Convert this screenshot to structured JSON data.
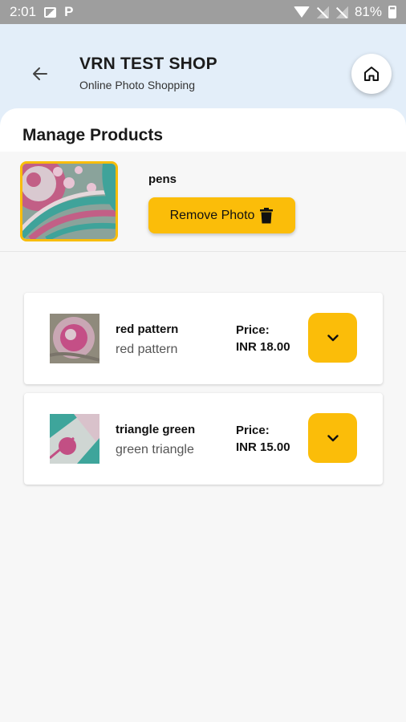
{
  "status_bar": {
    "time": "2:01",
    "battery": "81%",
    "icons": [
      "image-icon",
      "parking-icon",
      "wifi-icon",
      "signal-off-icon",
      "signal-off-icon",
      "battery-icon"
    ]
  },
  "header": {
    "title": "VRN TEST SHOP",
    "subtitle": "Online Photo Shopping",
    "back_icon": "back-arrow-icon",
    "home_icon": "home-icon",
    "background_color": "#e3eef9"
  },
  "page": {
    "section_title": "Manage Products"
  },
  "selected_product": {
    "name": "pens",
    "remove_label": "Remove Photo",
    "remove_icon": "trash-icon",
    "accent_color": "#fbbd09"
  },
  "products": [
    {
      "title": "red pattern",
      "subtitle": "red pattern",
      "price_label": "Price:",
      "price": "INR 18.00",
      "action_icon": "chevron-down-icon"
    },
    {
      "title": "triangle green",
      "subtitle": "green triangle",
      "price_label": "Price:",
      "price": "INR 15.00",
      "action_icon": "chevron-down-icon"
    }
  ]
}
